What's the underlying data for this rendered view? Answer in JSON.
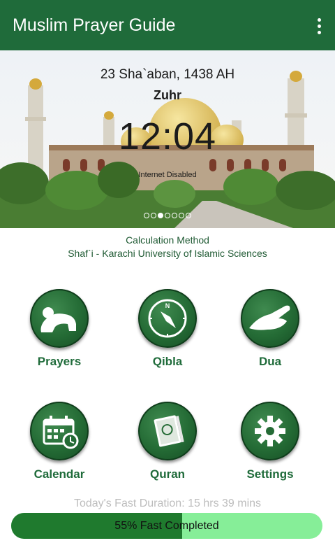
{
  "app": {
    "title": "Muslim Prayer Guide",
    "menu_icon": "overflow-menu-icon",
    "accent": "#1f6b3a"
  },
  "hero": {
    "hijri_date": "23 Sha`aban, 1438 AH",
    "current_prayer": "Zuhr",
    "time": "12:04",
    "status": "Internet Disabled",
    "slides": 7,
    "active_slide": 2
  },
  "calculation": {
    "heading": "Calculation Method",
    "method": "Shaf`i - Karachi University of Islamic Sciences"
  },
  "menu": [
    {
      "label": "Prayers",
      "icon": "prostration-icon"
    },
    {
      "label": "Qibla",
      "icon": "compass-icon"
    },
    {
      "label": "Dua",
      "icon": "praying-hand-icon"
    },
    {
      "label": "Calendar",
      "icon": "calendar-icon"
    },
    {
      "label": "Quran",
      "icon": "quran-book-icon"
    },
    {
      "label": "Settings",
      "icon": "gear-icon"
    }
  ],
  "fast": {
    "duration_text": "Today's Fast Duration: 15 hrs 39 mins",
    "progress_text": "55% Fast Completed",
    "progress_fraction": 0.55
  }
}
